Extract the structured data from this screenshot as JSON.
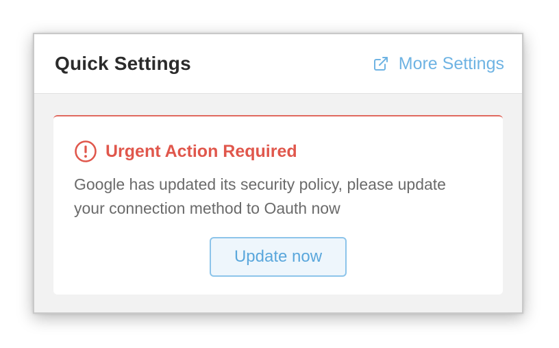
{
  "header": {
    "title": "Quick Settings",
    "more_settings_label": "More Settings",
    "more_settings_icon": "external-link-icon"
  },
  "alert": {
    "icon": "exclamation-circle-icon",
    "title": "Urgent Action Required",
    "message": "Google has updated its security policy, please update your connection method to Oauth now",
    "button_label": "Update now"
  },
  "colors": {
    "accent_blue": "#6eb3e3",
    "alert_red": "#e0574c",
    "panel_bg": "#f2f2f2"
  }
}
